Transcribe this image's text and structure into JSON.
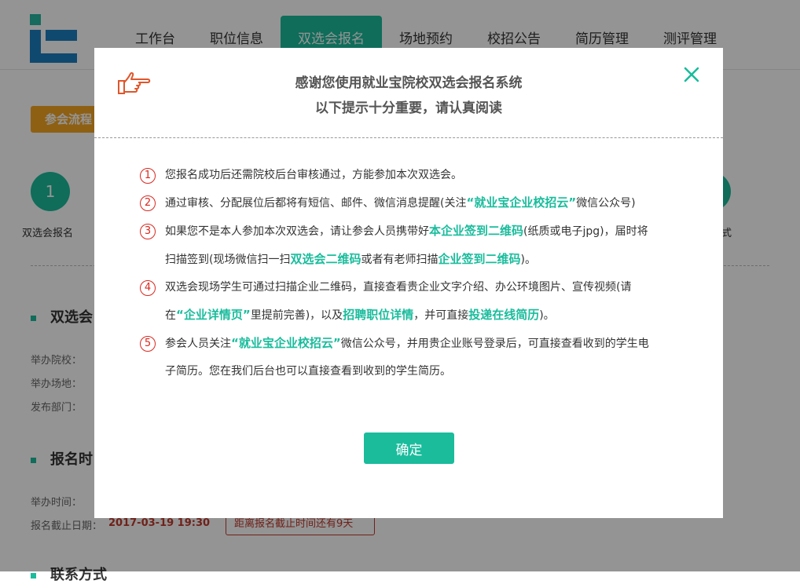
{
  "nav": {
    "items": [
      {
        "label": "工作台"
      },
      {
        "label": "职位信息"
      },
      {
        "label": "双选会报名"
      },
      {
        "label": "场地预约"
      },
      {
        "label": "校招公告"
      },
      {
        "label": "简历管理"
      },
      {
        "label": "测评管理"
      }
    ],
    "active_index": 2
  },
  "background": {
    "flow_tag": "参会流程",
    "step1_number": "1",
    "step1_label": "双选会报名",
    "step_right_label": "式",
    "section1_title": "双选会",
    "host_school_label": "举办院校：",
    "venue_label": "举办场地：",
    "department_label": "发布部门：",
    "section2_title": "报名时",
    "host_time_label": "举办时间：",
    "deadline_label": "报名截止日期：",
    "deadline_value": "2017-03-19 19:30",
    "countdown_text": "距离报名截止时间还有9天",
    "section3_title": "联系方式"
  },
  "modal": {
    "title_line1": "感谢您使用就业宝院校双选会报名系统",
    "title_line2": "以下提示十分重要，请认真阅读",
    "close_icon": "close-icon",
    "confirm_label": "确定",
    "tips": {
      "t1": {
        "num": "1",
        "text": "您报名成功后还需院校后台审核通过，方能参加本次双选会。"
      },
      "t2": {
        "num": "2",
        "a": "通过审核、分配展位后都将有短信、邮件、微信消息提醒(关注",
        "b": "“就业宝企业校招云”",
        "c": "微信公众号)"
      },
      "t3": {
        "num": "3",
        "a": "如果您不是本人参加本次双选会，请让参会人员携带好",
        "b": "本企业签到二维码",
        "c": "(纸质或电子jpg)，届时将扫描签到(现场微信扫一扫",
        "d": "双选会二维码",
        "e": "或者有老师扫描",
        "f": "企业签到二维码",
        "g": ")。"
      },
      "t4": {
        "num": "4",
        "a": "双选会现场学生可通过扫描企业二维码，直接查看贵企业文字介绍、办公环境图片、宣传视频(请在",
        "b": "“企业详情页”",
        "c": "里提前完善)，以及",
        "d": "招聘职位详情",
        "e": "，并可直接",
        "f": "投递在线简历",
        "g": ")。"
      },
      "t5": {
        "num": "5",
        "a": "参会人员关注",
        "b": "“就业宝企业校招云”",
        "c": "微信公众号，并用贵企业账号登录后，可直接查看收到的学生电子简历。您在我们后台也可以直接查看到收到的学生简历。"
      }
    }
  },
  "colors": {
    "accent": "#1abc9c",
    "warning": "#d9281f",
    "flow_tag": "#f5a623"
  }
}
